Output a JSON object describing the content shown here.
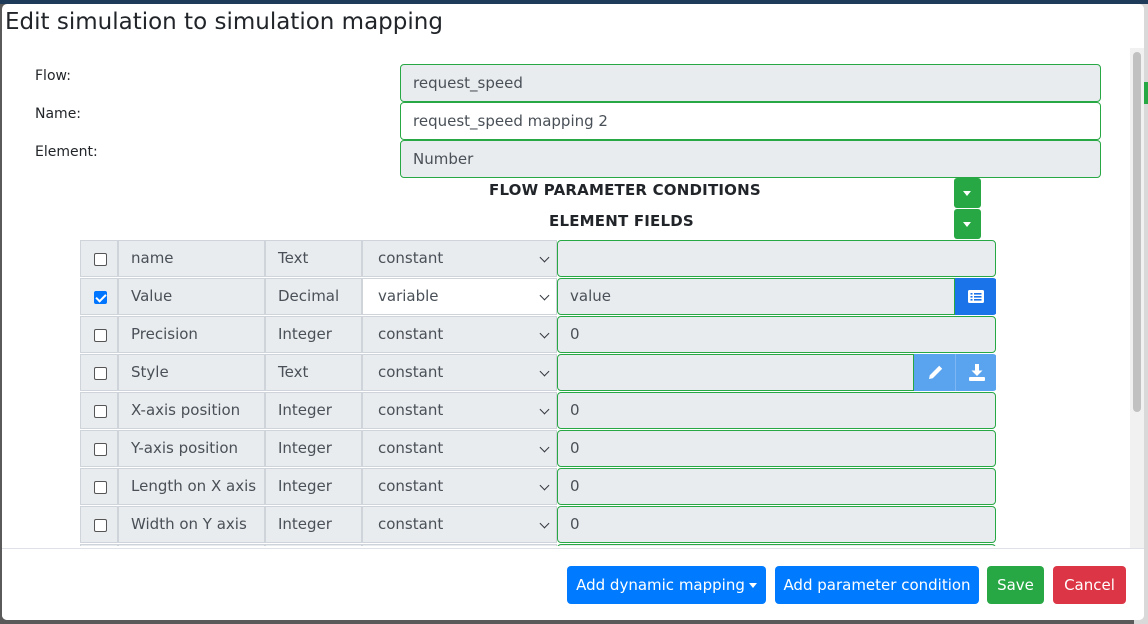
{
  "modal": {
    "title": "Edit simulation to simulation mapping"
  },
  "form": {
    "flow_label": "Flow:",
    "flow_value": "request_speed",
    "name_label": "Name:",
    "name_value": "request_speed mapping 2",
    "element_label": "Element:",
    "element_value": "Number"
  },
  "sections": {
    "flow_conditions": "FLOW PARAMETER CONDITIONS",
    "element_fields": "ELEMENT FIELDS"
  },
  "fields": [
    {
      "checked": false,
      "name": "name",
      "type": "Text",
      "mode": "constant",
      "value": ""
    },
    {
      "checked": true,
      "name": "Value",
      "type": "Decimal",
      "mode": "variable",
      "value": "value"
    },
    {
      "checked": false,
      "name": "Precision",
      "type": "Integer",
      "mode": "constant",
      "value": "0"
    },
    {
      "checked": false,
      "name": "Style",
      "type": "Text",
      "mode": "constant",
      "value": ""
    },
    {
      "checked": false,
      "name": "X-axis position",
      "type": "Integer",
      "mode": "constant",
      "value": "0"
    },
    {
      "checked": false,
      "name": "Y-axis position",
      "type": "Integer",
      "mode": "constant",
      "value": "0"
    },
    {
      "checked": false,
      "name": "Length on X axis",
      "type": "Integer",
      "mode": "constant",
      "value": "0"
    },
    {
      "checked": false,
      "name": "Width on Y axis",
      "type": "Integer",
      "mode": "constant",
      "value": "0"
    }
  ],
  "footer": {
    "add_dynamic": "Add dynamic mapping",
    "add_condition": "Add parameter condition",
    "save": "Save",
    "cancel": "Cancel"
  },
  "colors": {
    "primary": "#007bff",
    "success": "#28a745",
    "danger": "#dc3545"
  }
}
